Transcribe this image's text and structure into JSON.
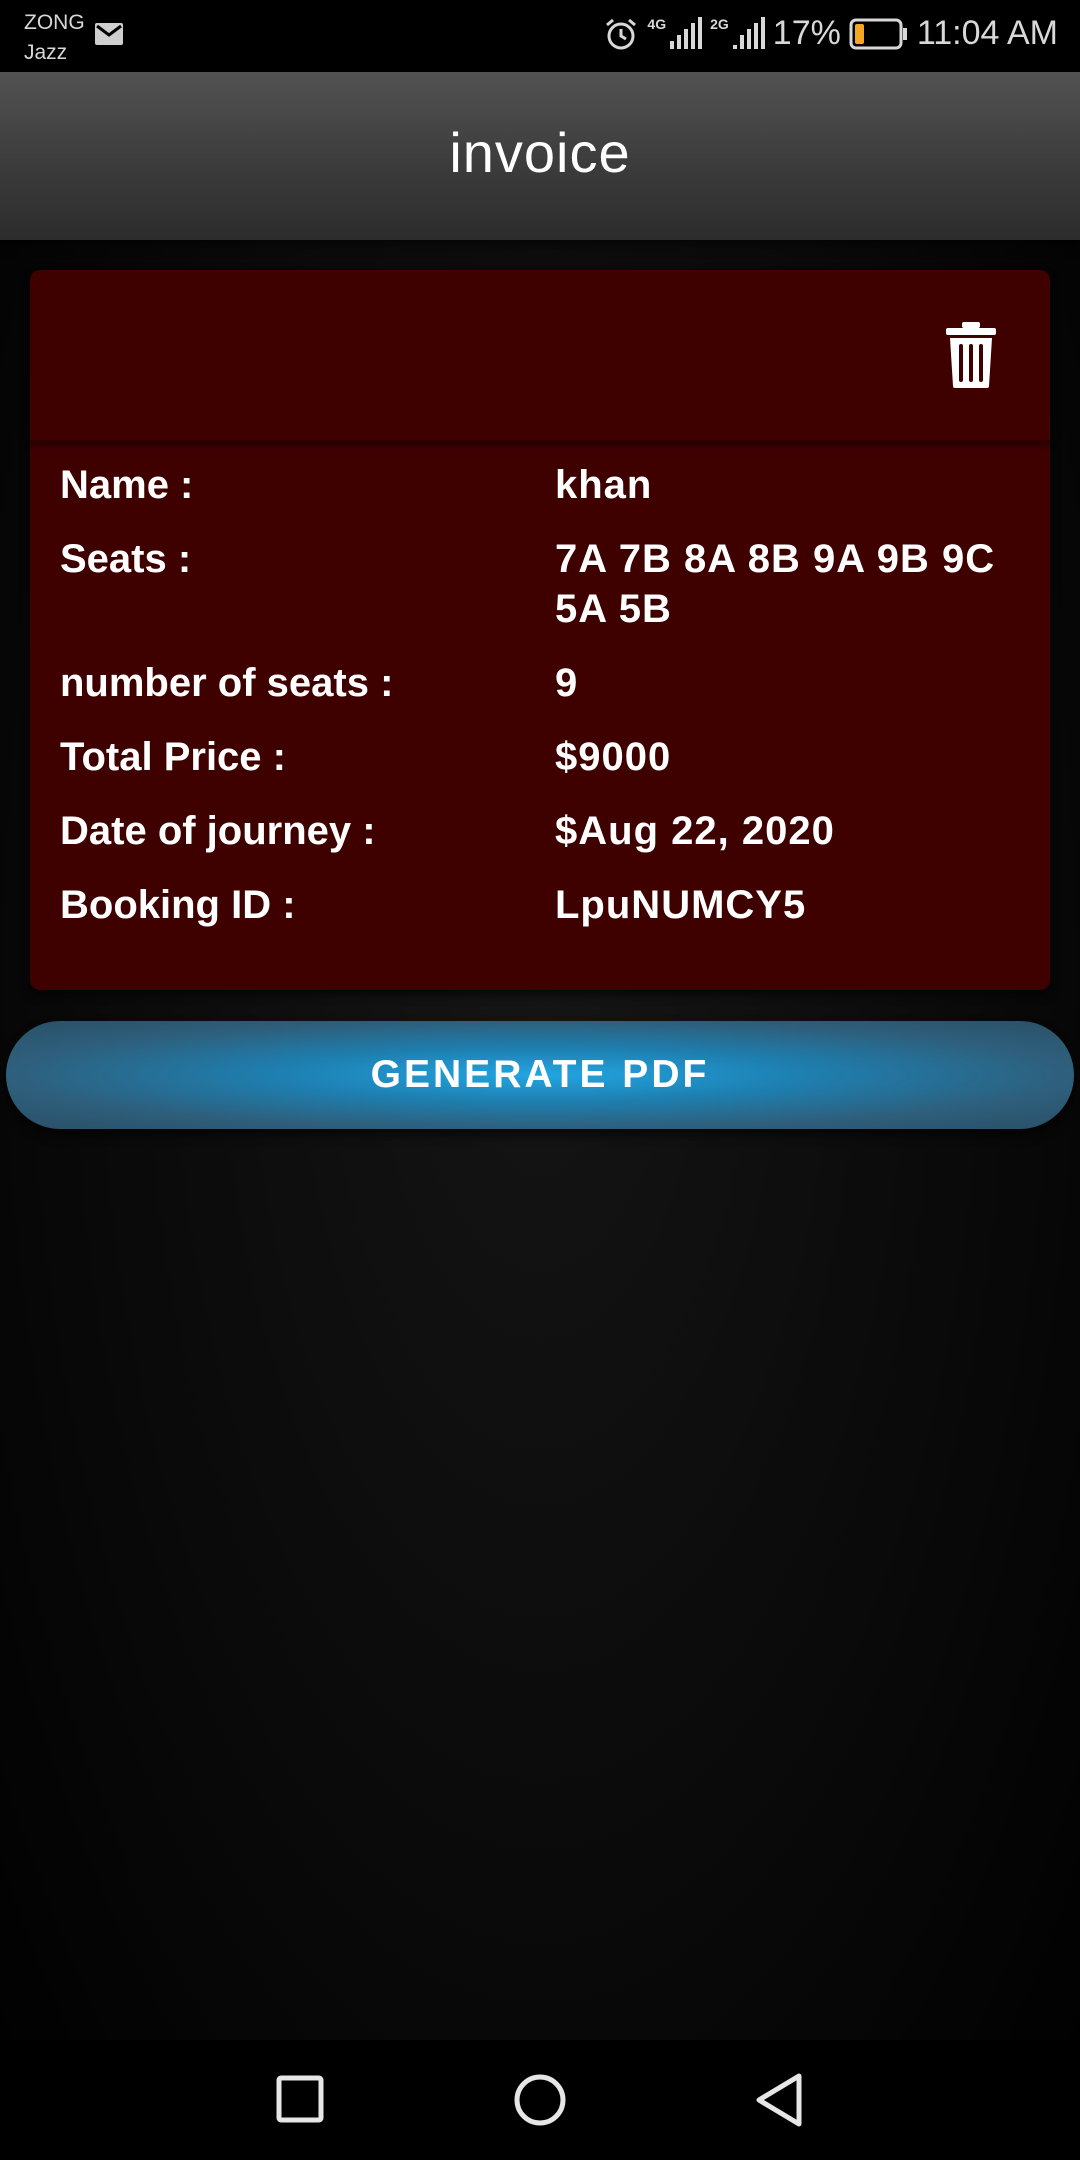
{
  "status_bar": {
    "carrier_1": "ZONG",
    "carrier_2": "Jazz",
    "network_1": "4G",
    "network_2": "2G",
    "battery": "17%",
    "time": "11:04 AM"
  },
  "app_bar": {
    "title": "invoice"
  },
  "card": {
    "rows": [
      {
        "label": "Name :",
        "value": "khan"
      },
      {
        "label": "Seats :",
        "value": "7A 7B 8A 8B 9A 9B 9C 5A 5B"
      },
      {
        "label": "number of seats :",
        "value": "9"
      },
      {
        "label": "Total Price :",
        "value": "$9000"
      },
      {
        "label": "Date of journey :",
        "value": "$Aug 22, 2020"
      },
      {
        "label": "Booking ID :",
        "value": "LpuNUMCY5"
      }
    ]
  },
  "generate_button": {
    "label": "GENERATE PDF"
  },
  "colors": {
    "card_bg": "#3f0000",
    "button_center": "#22a5e1",
    "battery_level": "#f5a623"
  },
  "icons": [
    "mail-icon",
    "alarm-icon",
    "signal-icon",
    "battery-icon",
    "trash-icon",
    "recents-icon",
    "home-icon",
    "back-icon"
  ]
}
